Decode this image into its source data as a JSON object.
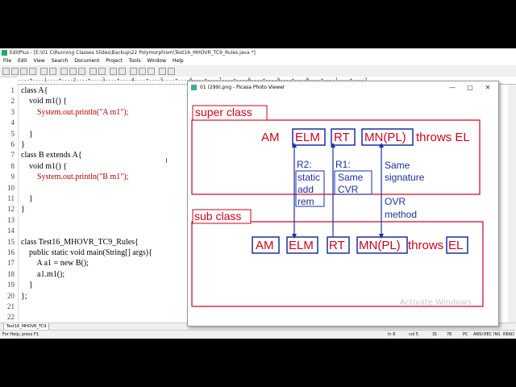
{
  "editor": {
    "title": "EditPlus - [E:\\01 C\\Running Classes Slides\\Backup\\22 Polymorphism\\Test16_MHOVR_TC9_Rules.java *]",
    "menu": [
      "File",
      "Edit",
      "View",
      "Search",
      "Document",
      "Project",
      "Tools",
      "Window",
      "Help"
    ],
    "ruler": "----+----1----+----2----+----3----+----4----+----5----+----6----+----7----+----8----+----9----+----0----+----1----+----2",
    "lines": [
      {
        "n": "1",
        "code": "class A{",
        "str": ""
      },
      {
        "n": "2",
        "code": "    void m1() {",
        "str": ""
      },
      {
        "n": "3",
        "code": "        System.out.println(\"A m1\");",
        "str": "System.out.println(\"A m1\");"
      },
      {
        "n": "4",
        "code": "",
        "str": ""
      },
      {
        "n": "5",
        "code": "    }",
        "str": ""
      },
      {
        "n": "6",
        "code": "}",
        "str": ""
      },
      {
        "n": "7",
        "code": "class B extends A{",
        "str": ""
      },
      {
        "n": "8",
        "code": "    void m1() {",
        "str": ""
      },
      {
        "n": "9",
        "code": "        System.out.println(\"B m1\");",
        "str": "System.out.println(\"B m1\");"
      },
      {
        "n": "10",
        "code": "",
        "str": ""
      },
      {
        "n": "11",
        "code": "    }",
        "str": ""
      },
      {
        "n": "12",
        "code": "}",
        "str": ""
      },
      {
        "n": "13",
        "code": "",
        "str": ""
      },
      {
        "n": "14",
        "code": "",
        "str": ""
      },
      {
        "n": "15",
        "code": "class Test16_MHOVR_TC9_Rules{",
        "str": ""
      },
      {
        "n": "16",
        "code": "    public static void main(String[] args){",
        "str": ""
      },
      {
        "n": "17",
        "code": "        A a1 = new B();",
        "str": ""
      },
      {
        "n": "18",
        "code": "        a1.m1();",
        "str": ""
      },
      {
        "n": "19",
        "code": "    }",
        "str": ""
      },
      {
        "n": "20",
        "code": "};",
        "str": ""
      },
      {
        "n": "21",
        "code": "",
        "str": ""
      },
      {
        "n": "22",
        "code": "",
        "str": ""
      }
    ],
    "tab": "Test16_MHOVR_TC9",
    "status": {
      "help": "For Help, press F1",
      "ln": "ln 8",
      "col": "col 5",
      "c1": "31",
      "c2": "76",
      "mode": "PC",
      "ansi": "ANSI",
      "rec": "REC",
      "ins": "INS",
      "read": "READ"
    }
  },
  "viewer": {
    "title": "01 (299).png - Picasa Photo Viewer",
    "minimize": "—",
    "maximize": "□",
    "close": "✕",
    "slide": {
      "super_label": "super class",
      "sub_label": "sub class",
      "super_row": {
        "am": "AM",
        "elm": "ELM",
        "rt": "RT",
        "mn": "MN(PL)",
        "throws": "throws EL"
      },
      "sub_row": {
        "am": "AM",
        "elm": "ELM",
        "rt": "RT",
        "mn": "MN(PL)",
        "throws": "throws",
        "el": "EL"
      },
      "r2": [
        "R2:",
        "static",
        "add",
        "rem"
      ],
      "r1": [
        "R1:",
        "Same",
        "CVR"
      ],
      "same_sig": [
        "Same",
        "signature"
      ],
      "ovr": [
        "OVR",
        "method"
      ]
    }
  },
  "watermark": "Activate Windows",
  "colors": {
    "accent": "#d0021b",
    "blue": "#1a2fa0"
  }
}
